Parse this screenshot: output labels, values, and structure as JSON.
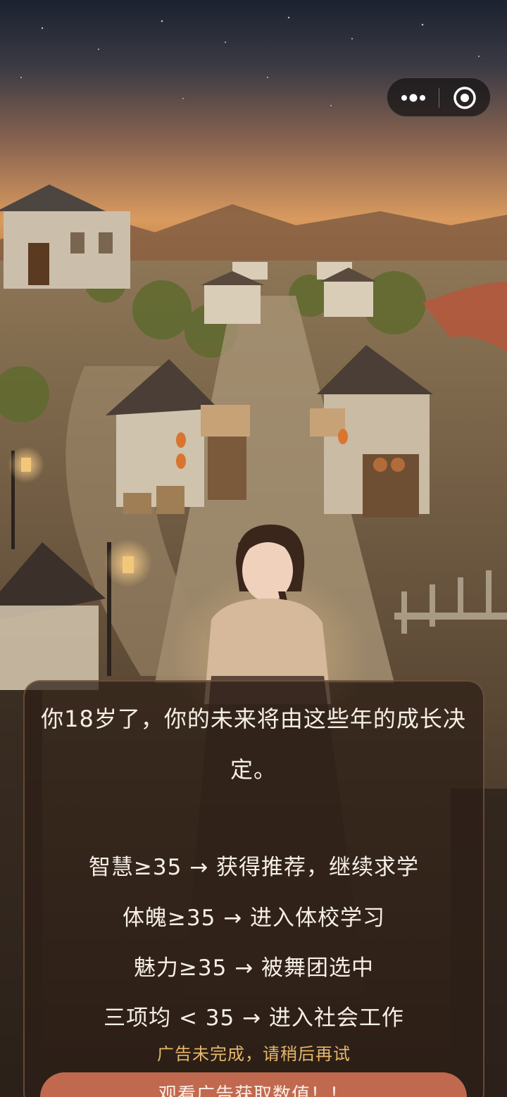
{
  "story": {
    "intro": "你18岁了，你的未来将由这些年的成长决定。",
    "rules": [
      "智慧≥35 → 获得推荐，继续求学",
      "体魄≥35 → 进入体校学习",
      "魅力≥35 → 被舞团选中",
      "三项均 < 35 → 进入社会工作"
    ]
  },
  "toast": {
    "message": "广告未完成，请稍后再试"
  },
  "ad_button": {
    "label": "观看广告获取数值！！"
  },
  "capsule": {
    "more_icon": "more-dots-icon",
    "close_icon": "target-circle-icon"
  },
  "colors": {
    "accent": "#c0694f",
    "toast": "#e6b86a",
    "panel": "#2d1e16"
  }
}
